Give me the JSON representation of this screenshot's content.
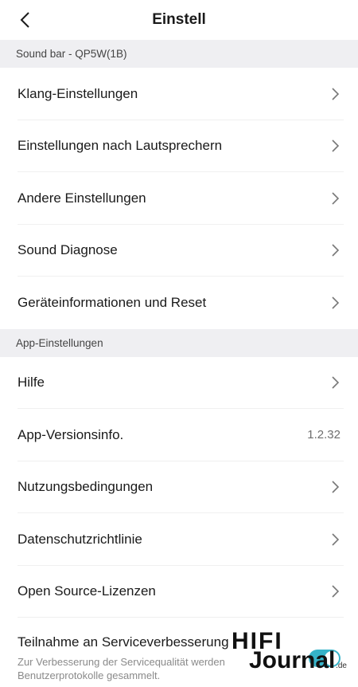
{
  "header": {
    "title": "Einstell",
    "back_icon": "chevron-left-icon"
  },
  "sections": [
    {
      "title": "Sound bar - QP5W(1B)",
      "items": [
        {
          "label": "Klang-Einstellungen"
        },
        {
          "label": "Einstellungen nach Lautsprechern"
        },
        {
          "label": "Andere Einstellungen"
        },
        {
          "label": "Sound Diagnose"
        },
        {
          "label": "Geräteinformationen und Reset"
        }
      ]
    },
    {
      "title": "App-Einstellungen",
      "items": [
        {
          "label": "Hilfe"
        },
        {
          "label": "App-Versionsinfo.",
          "value": "1.2.32"
        },
        {
          "label": "Nutzungsbedingungen"
        },
        {
          "label": "Datenschutzrichtlinie"
        },
        {
          "label": "Open Source-Lizenzen"
        }
      ]
    }
  ],
  "service": {
    "title": "Teilnahme an Serviceverbesserung",
    "description": "Zur Verbesserung der Servicequalität werden Benutzerprotokolle gesammelt.",
    "toggle_on": true
  },
  "watermark": {
    "line1": "HIFI",
    "line2": "Journal",
    "suffix": ".de"
  },
  "colors": {
    "section_bg": "#efeff2",
    "toggle_on": "#36b3c9",
    "text_primary": "#1a1a1a",
    "text_secondary": "#8a8a8a"
  }
}
